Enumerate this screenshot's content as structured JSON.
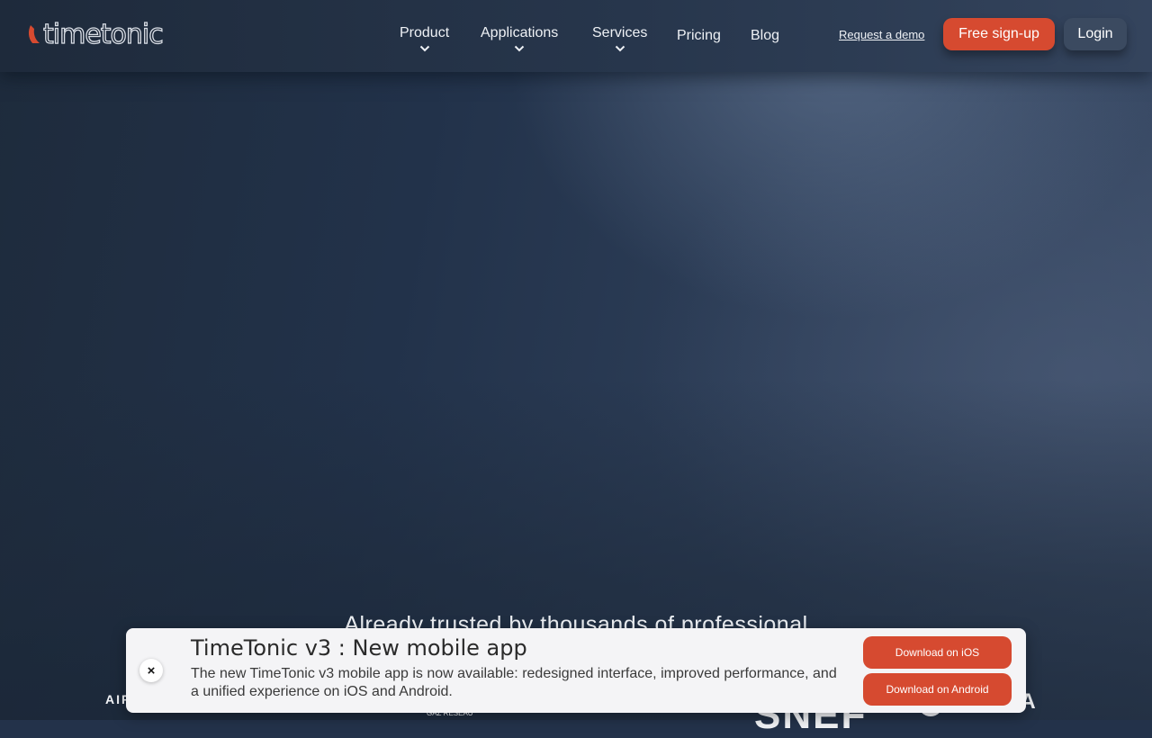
{
  "header": {
    "logo_text": "timetonic",
    "nav": [
      {
        "label": "Product",
        "has_dropdown": true
      },
      {
        "label": "Applications",
        "has_dropdown": true
      },
      {
        "label": "Services",
        "has_dropdown": true
      },
      {
        "label": "Pricing",
        "has_dropdown": false
      },
      {
        "label": "Blog",
        "has_dropdown": false
      }
    ],
    "request_demo_label": "Request a demo",
    "signup_label": "Free sign-up",
    "login_label": "Login"
  },
  "hero": {
    "trusted_text": "Already trusted by thousands of professional"
  },
  "clients": {
    "logo_1": "AIR",
    "logo_2": "SNEF",
    "logo_3": "HA",
    "logo_4": "GAZ RESEAU"
  },
  "banner": {
    "close_icon": "×",
    "title": "TimeTonic v3 : New mobile app",
    "description": "The new TimeTonic v3 mobile app is now available: redesigned interface, improved performance, and a unified experience on iOS and Android.",
    "ios_label": "Download on iOS",
    "android_label": "Download on Android"
  },
  "colors": {
    "accent": "#d64a30",
    "header_bg": "#1e2a3b",
    "banner_bg": "#f4f4f6"
  }
}
